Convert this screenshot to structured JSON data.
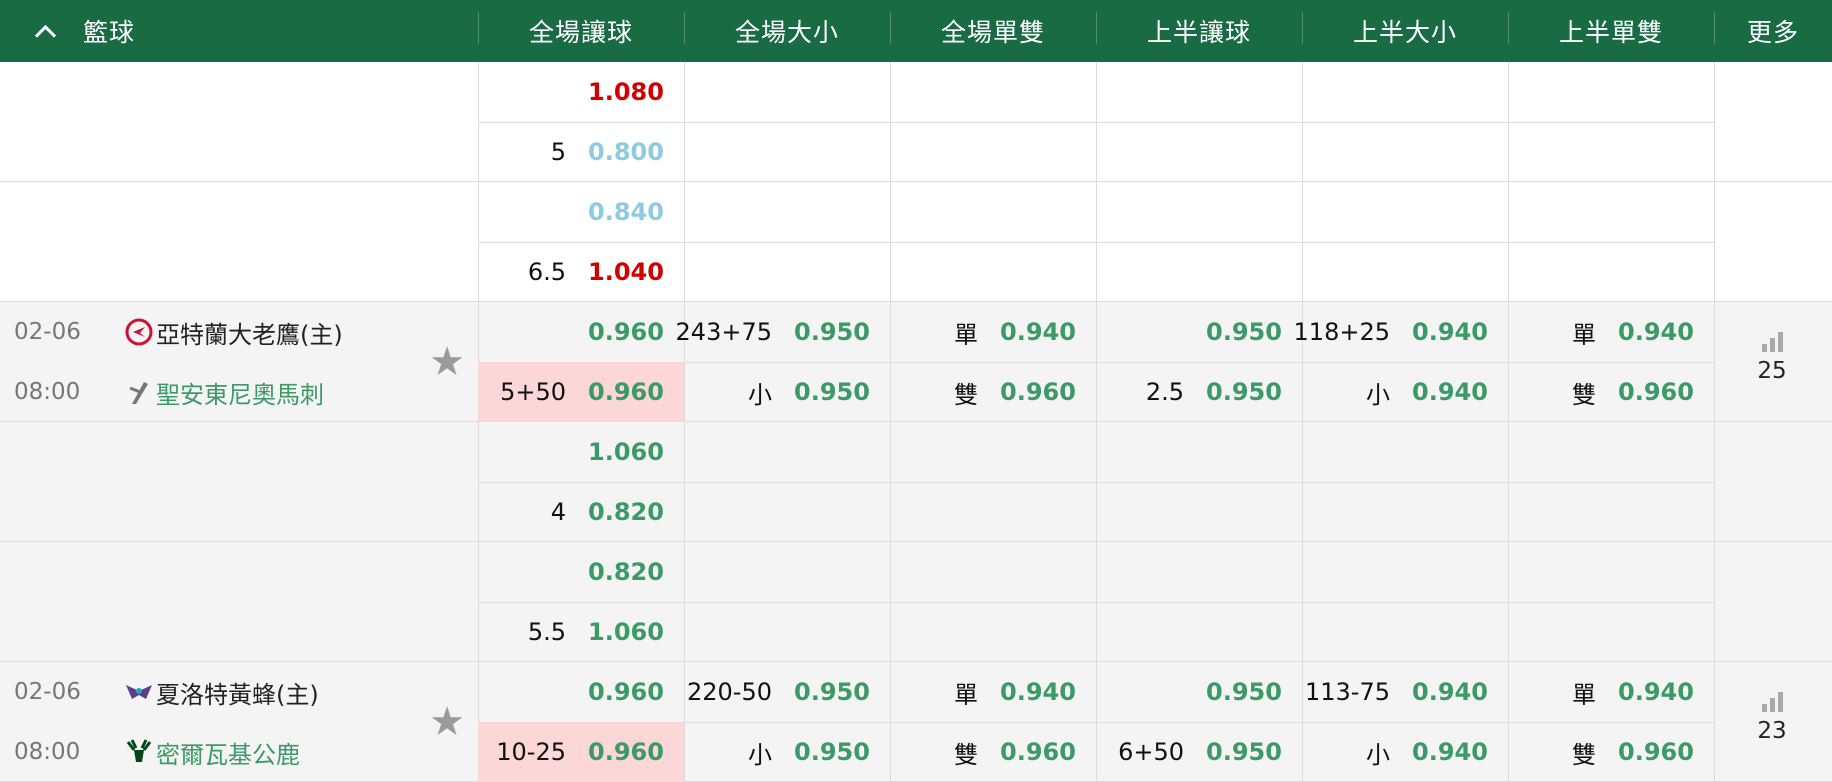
{
  "header": {
    "sport": "籃球",
    "columns": [
      "全場讓球",
      "全場大小",
      "全場單雙",
      "上半讓球",
      "上半大小",
      "上半單雙",
      "更多"
    ]
  },
  "blocks": [
    {
      "type": "extra",
      "rows": [
        {
          "h": "",
          "v": "1.080",
          "color": "red"
        },
        {
          "h": "5",
          "v": "0.800",
          "color": "blue"
        }
      ]
    },
    {
      "type": "extra",
      "rows": [
        {
          "h": "",
          "v": "0.840",
          "color": "blue"
        },
        {
          "h": "6.5",
          "v": "1.040",
          "color": "red"
        }
      ]
    },
    {
      "type": "match",
      "date": "02-06",
      "time": "08:00",
      "home": "亞特蘭大老鷹(主)",
      "away": "聖安東尼奧馬刺",
      "home_logo": "hawks-logo-icon",
      "away_logo": "spurs-logo-icon",
      "more_count": "25",
      "rows": [
        {
          "hcp_h": "",
          "hcp_v": "0.960",
          "ou_h": "243+75",
          "ou_v": "0.950",
          "oe_h": "單",
          "oe_v": "0.940",
          "h1_h": "",
          "h1_v": "0.950",
          "h1ou_h": "118+25",
          "h1ou_v": "0.940",
          "h1oe_h": "單",
          "h1oe_v": "0.940"
        },
        {
          "hcp_h": "5+50",
          "hcp_v": "0.960",
          "ou_h": "小",
          "ou_v": "0.950",
          "oe_h": "雙",
          "oe_v": "0.960",
          "h1_h": "2.5",
          "h1_v": "0.950",
          "h1ou_h": "小",
          "h1ou_v": "0.940",
          "h1oe_h": "雙",
          "h1oe_v": "0.960"
        }
      ]
    },
    {
      "type": "extra",
      "rows": [
        {
          "h": "",
          "v": "1.060",
          "color": "green"
        },
        {
          "h": "4",
          "v": "0.820",
          "color": "green"
        }
      ]
    },
    {
      "type": "extra",
      "rows": [
        {
          "h": "",
          "v": "0.820",
          "color": "green"
        },
        {
          "h": "5.5",
          "v": "1.060",
          "color": "green"
        }
      ]
    },
    {
      "type": "match",
      "date": "02-06",
      "time": "08:00",
      "home": "夏洛特黃蜂(主)",
      "away": "密爾瓦基公鹿",
      "home_logo": "hornets-logo-icon",
      "away_logo": "bucks-logo-icon",
      "more_count": "23",
      "rows": [
        {
          "hcp_h": "",
          "hcp_v": "0.960",
          "ou_h": "220-50",
          "ou_v": "0.950",
          "oe_h": "單",
          "oe_v": "0.940",
          "h1_h": "",
          "h1_v": "0.950",
          "h1ou_h": "113-75",
          "h1ou_v": "0.940",
          "h1oe_h": "單",
          "h1oe_v": "0.940"
        },
        {
          "hcp_h": "10-25",
          "hcp_v": "0.960",
          "ou_h": "小",
          "ou_v": "0.950",
          "oe_h": "雙",
          "oe_v": "0.960",
          "h1_h": "6+50",
          "h1_v": "0.950",
          "h1ou_h": "小",
          "h1ou_v": "0.940",
          "h1oe_h": "雙",
          "h1oe_v": "0.960"
        }
      ]
    }
  ],
  "colors": {
    "header_bg": "#196b44",
    "odds_green": "#3c9a67",
    "odds_red": "#d40000",
    "odds_blue": "#8ecbe0",
    "highlight": "#fcd7d7"
  }
}
